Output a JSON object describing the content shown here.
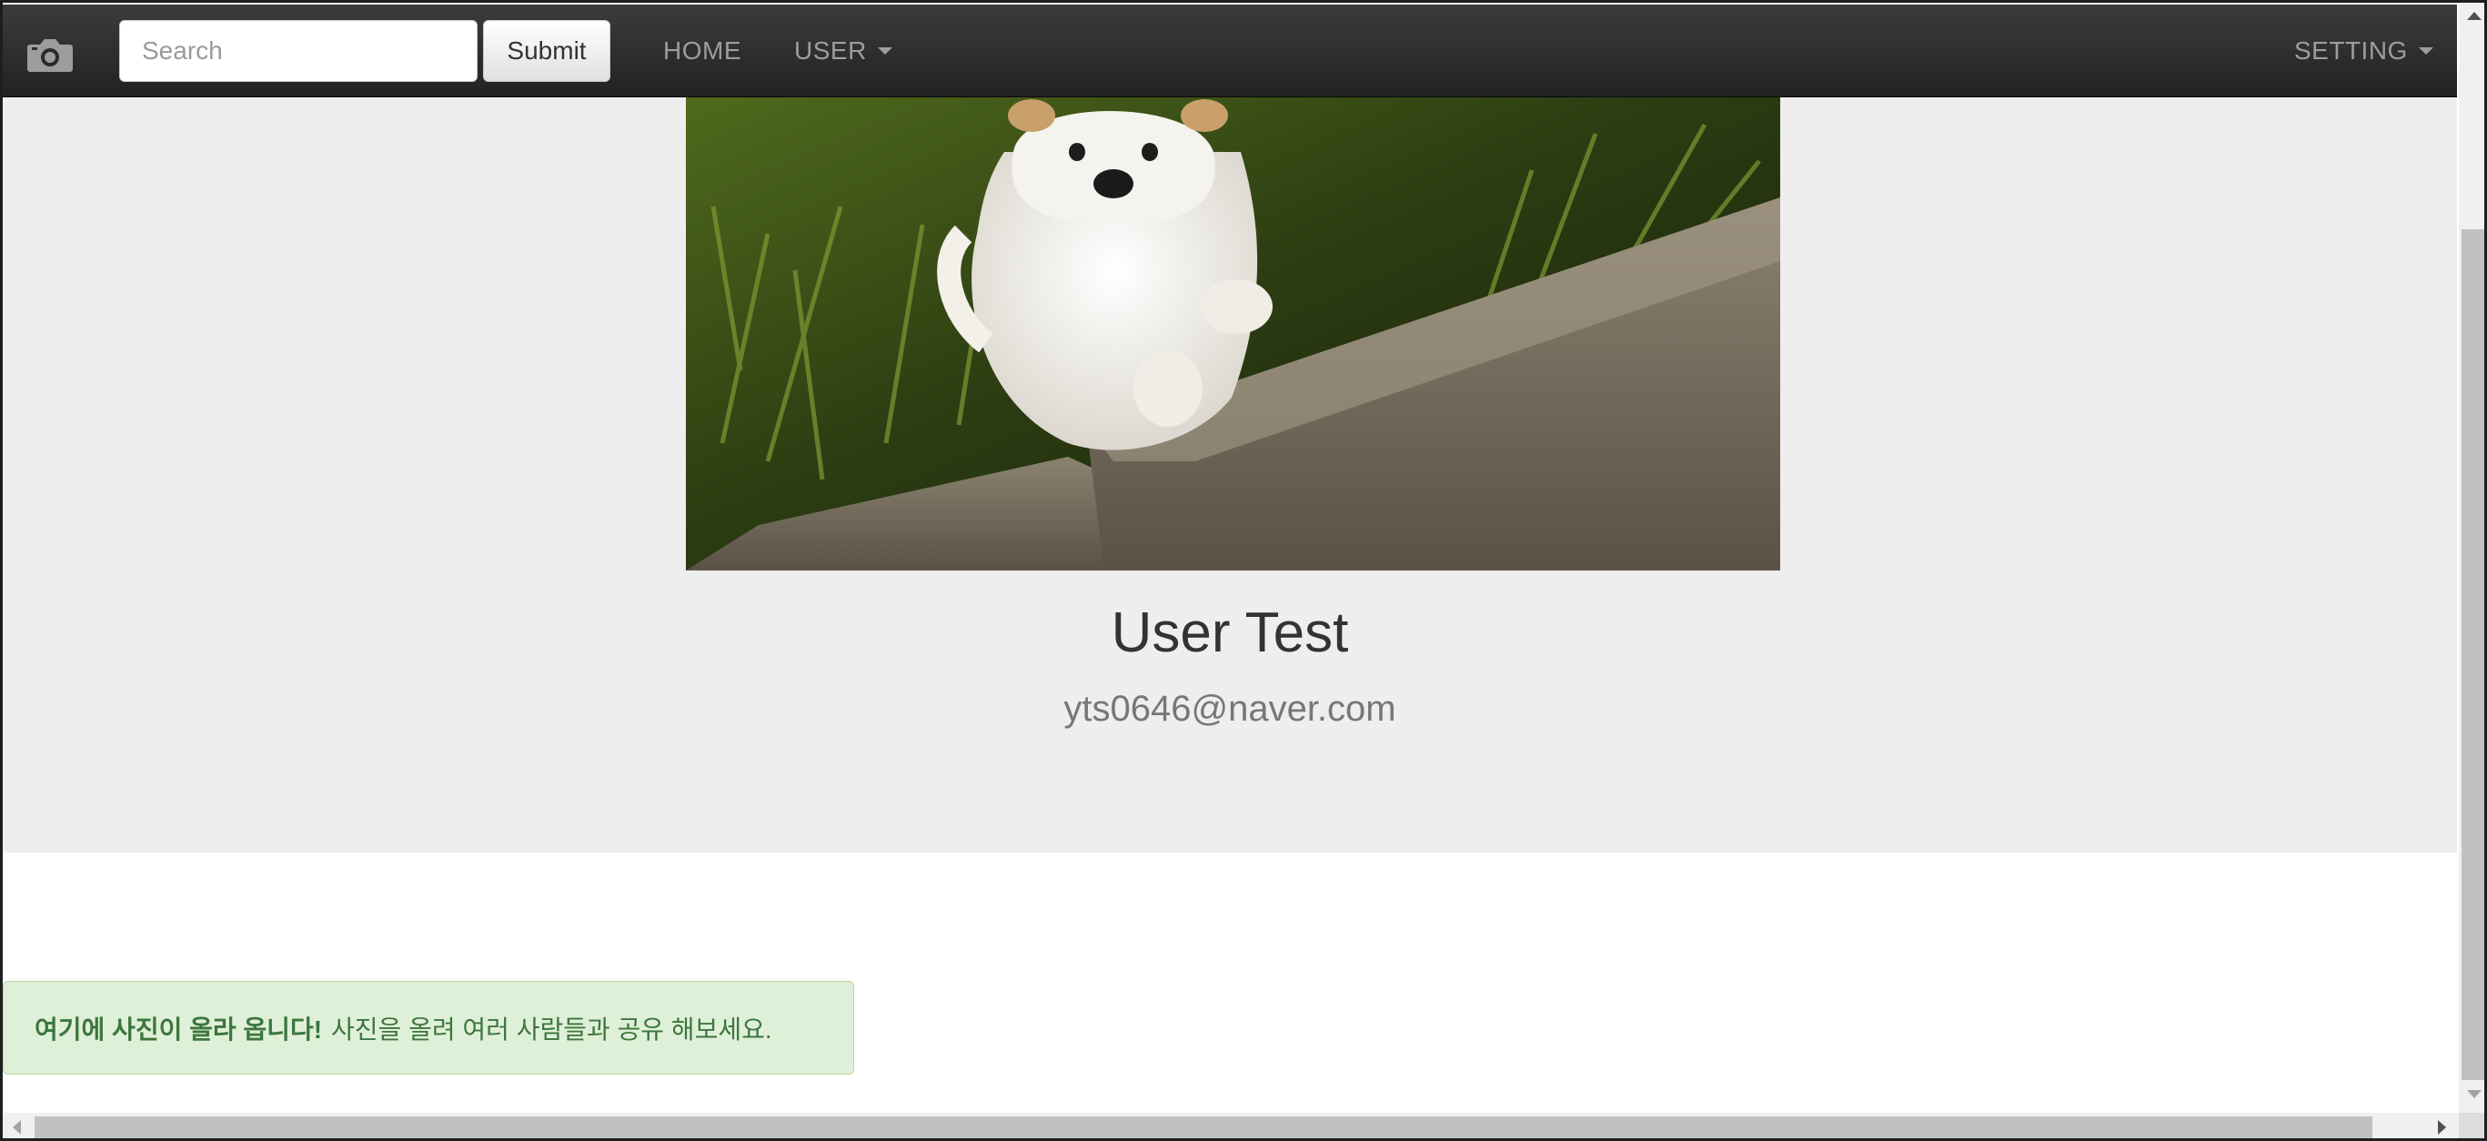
{
  "navbar": {
    "brand_icon": "camera-icon",
    "search": {
      "placeholder": "Search",
      "value": ""
    },
    "submit_label": "Submit",
    "home_label": "HOME",
    "user_label": "USER",
    "setting_label": "SETTING"
  },
  "profile": {
    "name": "User Test",
    "email": "yts0646@naver.com"
  },
  "alert": {
    "strong": "여기에 사진이 올라 옵니다!",
    "text": "사진을 올려 여러 사람들과 공유 해보세요."
  },
  "colors": {
    "navbar": "#222222",
    "hero_bg": "#eeeeee",
    "alert_bg": "#dff0d8",
    "alert_text": "#3c763d"
  }
}
